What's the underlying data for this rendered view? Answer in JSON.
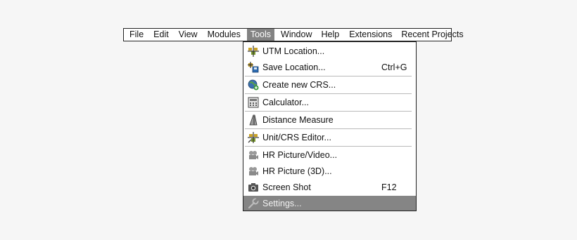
{
  "menubar": {
    "items": [
      "File",
      "Edit",
      "View",
      "Modules",
      "Tools",
      "Window",
      "Help",
      "Extensions",
      "Recent Projects"
    ],
    "active": "Tools"
  },
  "menu": {
    "items": [
      {
        "label": "UTM Location...",
        "shortcut": "",
        "icon": "utm-location-icon"
      },
      {
        "label": "Save Location...",
        "shortcut": "Ctrl+G",
        "icon": "save-location-icon"
      },
      {
        "label": "Create new CRS...",
        "shortcut": "",
        "icon": "globe-add-icon"
      },
      {
        "label": "Calculator...",
        "shortcut": "",
        "icon": "calculator-icon"
      },
      {
        "label": "Distance Measure",
        "shortcut": "",
        "icon": "distance-measure-icon"
      },
      {
        "label": "Unit/CRS Editor...",
        "shortcut": "",
        "icon": "unit-editor-icon"
      },
      {
        "label": "HR Picture/Video...",
        "shortcut": "",
        "icon": "video-camera-icon"
      },
      {
        "label": "HR Picture (3D)...",
        "shortcut": "",
        "icon": "video-camera-3d-icon"
      },
      {
        "label": "Screen Shot",
        "shortcut": "F12",
        "icon": "camera-icon"
      },
      {
        "label": "Settings...",
        "shortcut": "",
        "icon": "wrench-icon"
      }
    ]
  },
  "colors": {
    "highlight": "#858585",
    "background": "#f6f6f6"
  }
}
